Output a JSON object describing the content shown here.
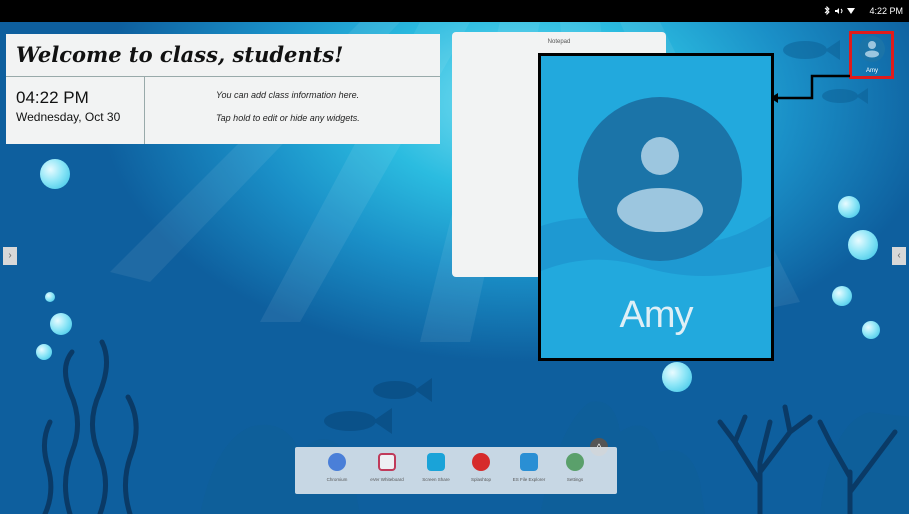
{
  "status_bar": {
    "icons": [
      "bluetooth-icon",
      "volume-icon",
      "wifi-icon"
    ],
    "time": "4:22 PM"
  },
  "welcome_widget": {
    "title": "Welcome to class, students!",
    "clock": "04:22 PM",
    "date": "Wednesday, Oct 30",
    "info_line1": "You can add class information here.",
    "info_line2": "Tap hold to edit or hide any widgets."
  },
  "notepad": {
    "title": "Notepad"
  },
  "user": {
    "name": "Amy",
    "zoom_label": "Amy"
  },
  "dock": {
    "items": [
      {
        "label": "Chromium",
        "icon": "chromium-icon",
        "color": "#4a7fd8"
      },
      {
        "label": "eVer Whiteboard",
        "icon": "whiteboard-icon",
        "color": "#c03a5a"
      },
      {
        "label": "Screen Share",
        "icon": "screen-share-icon",
        "color": "#1aa3d8"
      },
      {
        "label": "Splashtop",
        "icon": "splashtop-icon",
        "color": "#d62b2b"
      },
      {
        "label": "ES File Explorer",
        "icon": "file-explorer-icon",
        "color": "#2a8fd4"
      },
      {
        "label": "Settings",
        "icon": "settings-icon",
        "color": "#5aa06b"
      }
    ]
  },
  "colors": {
    "highlight_red": "#e01b1b",
    "avatar_blue": "#1b74a8",
    "zoom_bg": "#22a9dd"
  }
}
